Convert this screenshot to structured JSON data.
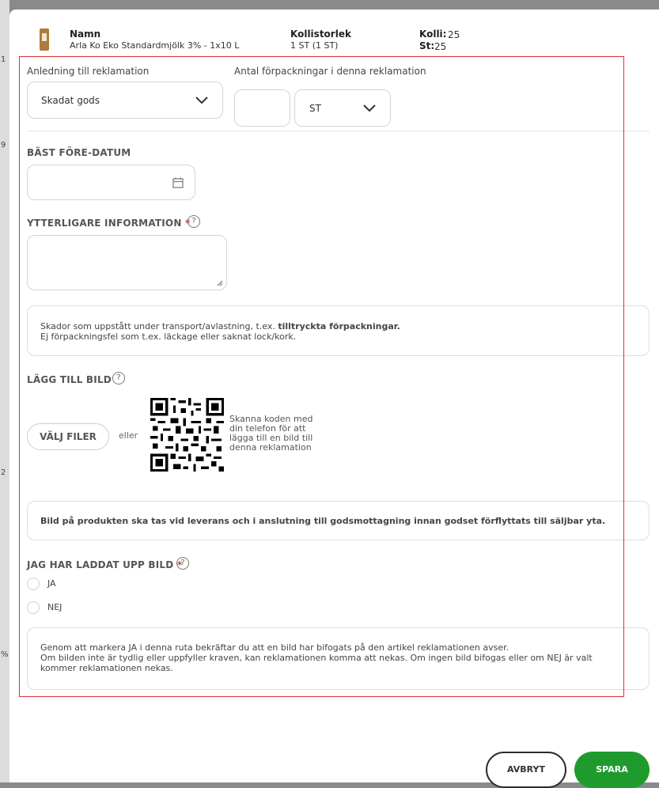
{
  "backdrop": {
    "marks": [
      "1",
      "9",
      "2",
      "%"
    ]
  },
  "product": {
    "name_label": "Namn",
    "name_value": "Arla Ko Eko Standardmjölk 3% - 1x10 L",
    "size_label": "Kollistorlek",
    "size_value": "1 ST (1 ST)",
    "kolli_label": "Kolli:",
    "kolli_value": "25",
    "st_label": "St:",
    "st_value": "25"
  },
  "reason": {
    "label": "Anledning till reklamation",
    "value": "Skadat gods"
  },
  "packages": {
    "label": "Antal förpackningar i denna reklamation",
    "count_value": "",
    "unit_value": "ST"
  },
  "best_before": {
    "title": "BÄST FÖRE-DATUM",
    "value": "",
    "icon": "calendar-icon"
  },
  "additional_info": {
    "title": "YTTERLIGARE INFORMATION",
    "required_mark": "*",
    "help": "?",
    "value": ""
  },
  "damage_note": {
    "line1_prefix": "Skador som uppstått under transport/avlastning, t.ex.",
    "line1_bold": "tilltryckta förpackningar.",
    "line2": "Ej förpackningsfel som t.ex. läckage eller saknat lock/kork."
  },
  "add_image": {
    "title": "LÄGG TILL BILD",
    "help": "?",
    "choose_button": "VÄLJ FILER",
    "or_text": "eller",
    "qr_text": "Skanna koden med din telefon för att lägga till en bild till denna reklamation"
  },
  "image_note": {
    "text": "Bild på produkten ska tas vid leverans och i anslutning till godsmottagning innan godset förflyttats till säljbar yta."
  },
  "uploaded": {
    "title": "JAG HAR LADDAT UPP BILD",
    "required_mark": "*",
    "help": "?",
    "options": [
      "JA",
      "NEJ"
    ]
  },
  "confirm_note": {
    "line1": "Genom att markera JA i denna ruta bekräftar du att en bild har bifogats på den artikel reklamationen avser.",
    "line2": "Om bilden inte är tydlig eller uppfyller kraven, kan reklamationen komma att nekas. Om ingen bild bifogas eller om NEJ är valt",
    "line3": "kommer reklamationen nekas."
  },
  "actions": {
    "cancel": "AVBRYT",
    "save": "SPARA"
  },
  "colors": {
    "accent_green": "#1f9b2e",
    "required_red": "#e0302e",
    "frame_red": "#e0302e"
  }
}
